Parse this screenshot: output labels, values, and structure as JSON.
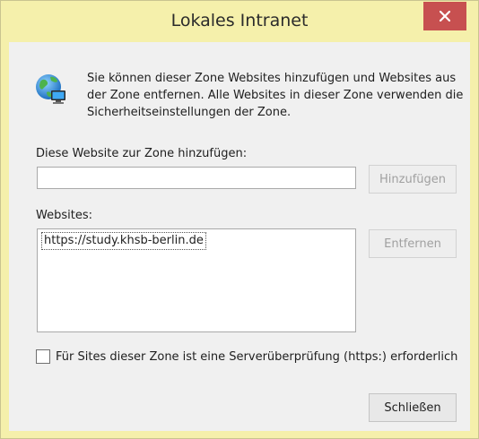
{
  "window": {
    "title": "Lokales Intranet",
    "close_icon": "close-icon"
  },
  "info": {
    "icon": "globe-computer-icon",
    "text": "Sie können dieser Zone Websites hinzufügen und Websites aus der Zone entfernen. Alle Websites in dieser Zone verwenden die Sicherheitseinstellungen der Zone."
  },
  "add_site": {
    "label": "Diese Website zur Zone hinzufügen:",
    "value": "",
    "placeholder": "",
    "button_label": "Hinzufügen",
    "button_enabled": false
  },
  "websites": {
    "label": "Websites:",
    "items": [
      "https://study.khsb-berlin.de"
    ],
    "remove_button_label": "Entfernen",
    "remove_button_enabled": false
  },
  "https_check": {
    "label": "Für Sites dieser Zone ist eine Serverüberprüfung (https:) erforderlich",
    "checked": false
  },
  "footer": {
    "close_label": "Schließen"
  },
  "colors": {
    "frame": "#f5f0ab",
    "close_button": "#c75050",
    "client_bg": "#f0f0f0"
  }
}
